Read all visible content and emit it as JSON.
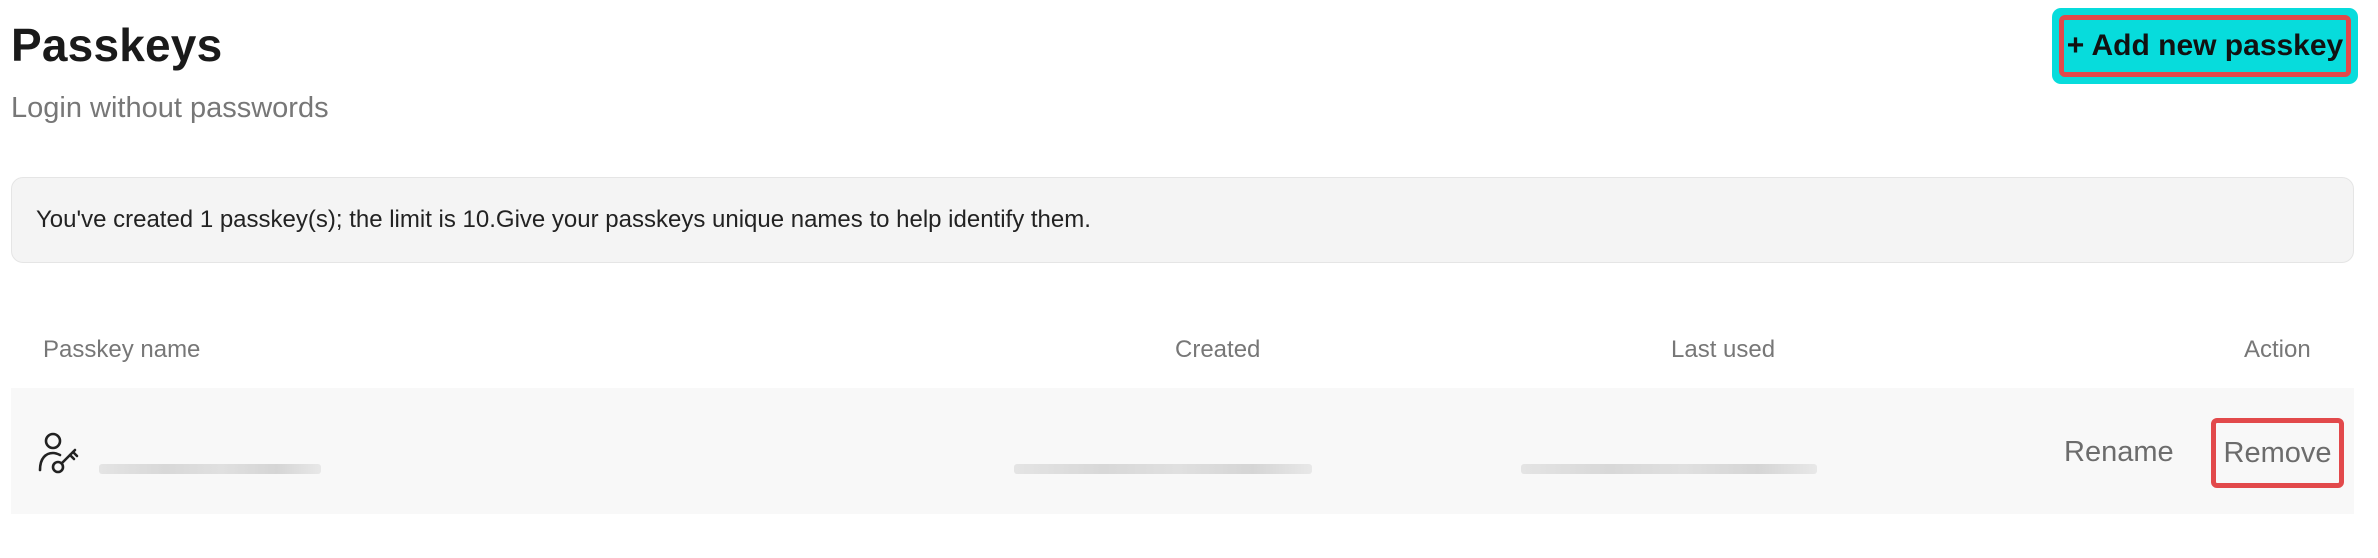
{
  "header": {
    "title": "Passkeys",
    "subtitle": "Login without passwords",
    "add_button_label": "+ Add new passkey"
  },
  "notice": {
    "text": "You've created 1 passkey(s); the limit is 10.Give your passkeys unique names to help identify them."
  },
  "table": {
    "columns": [
      "Passkey name",
      "Created",
      "Last used",
      "Action"
    ],
    "rows": [
      {
        "icon": "passkey-icon",
        "actions": [
          "Rename",
          "Remove"
        ]
      }
    ]
  },
  "colors": {
    "accent_cyan": "#07dcdc",
    "highlight_red": "#e2494b",
    "notice_bg": "#f4f4f4",
    "row_bg": "#f8f8f8"
  }
}
